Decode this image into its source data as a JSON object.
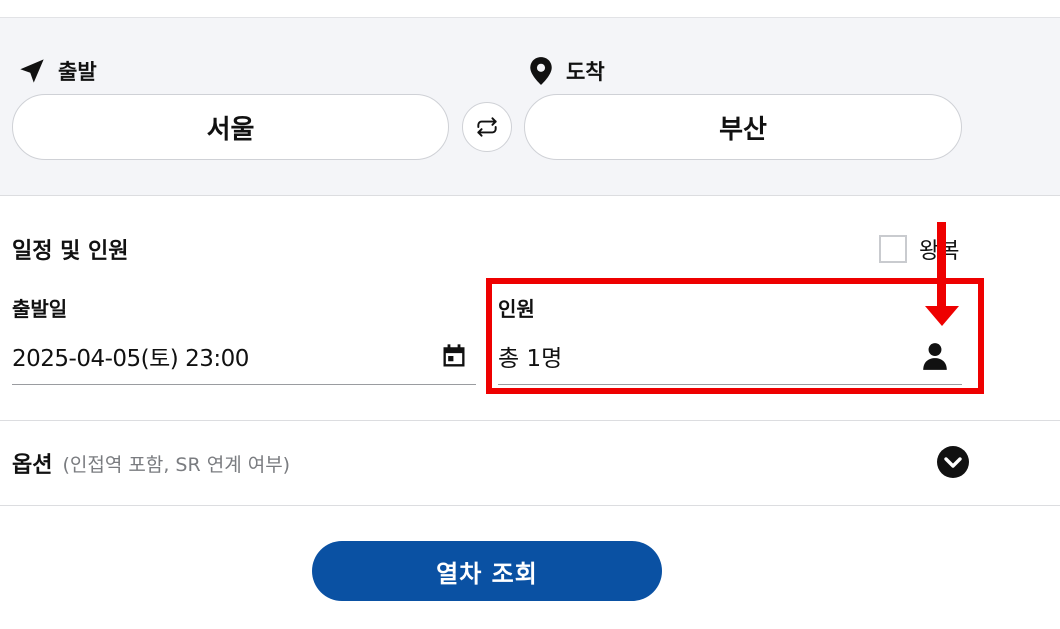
{
  "route": {
    "departure_label": "출발",
    "arrival_label": "도착",
    "departure_station": "서울",
    "arrival_station": "부산"
  },
  "schedule": {
    "section_title": "일정 및 인원",
    "roundtrip_label": "왕복",
    "roundtrip_checked": false,
    "date_label": "출발일",
    "date_value": "2025-04-05(토) 23:00",
    "passenger_label": "인원",
    "passenger_value": "총 1명"
  },
  "options": {
    "title": "옵션",
    "subtitle": "(인접역 포함, SR 연계 여부)"
  },
  "search_button_label": "열차 조회",
  "colors": {
    "primary": "#0a51a3",
    "panel_bg": "#f4f5f8",
    "annotation": "#ee0000"
  },
  "icons": [
    "paper-plane-icon",
    "location-pin-icon",
    "swap-icon",
    "calendar-icon",
    "person-icon",
    "chevron-down-icon"
  ]
}
